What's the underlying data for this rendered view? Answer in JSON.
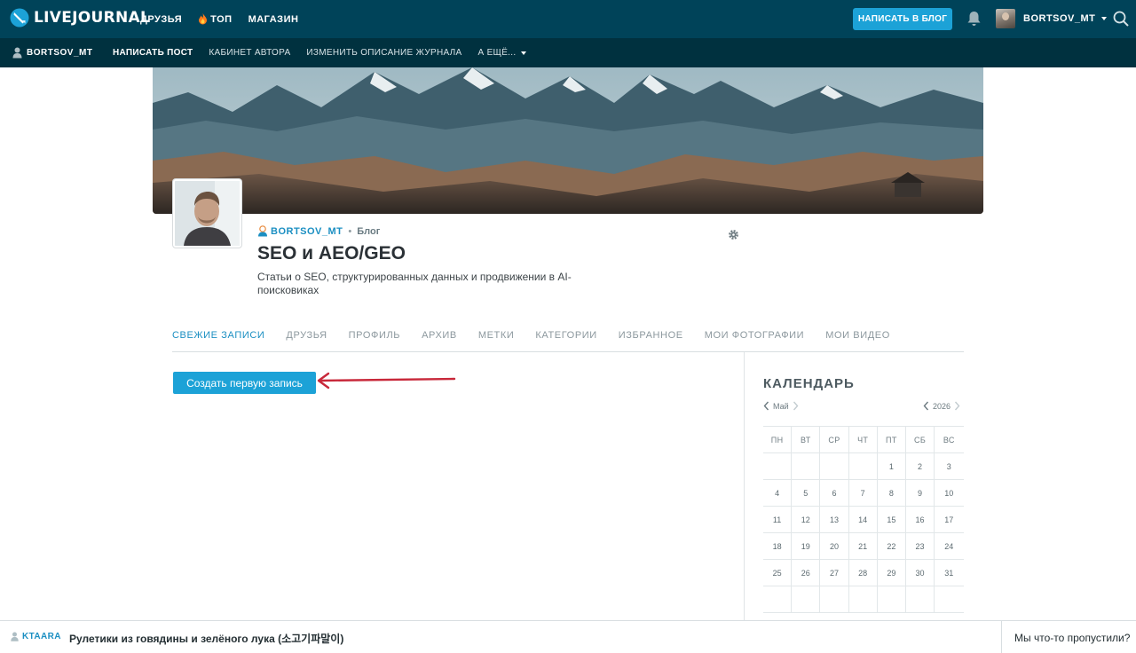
{
  "topbar": {
    "logo_text": "LIVEJOURNAL",
    "nav": [
      "ДРУЗЬЯ",
      "ТОП",
      "МАГАЗИН"
    ],
    "write_button": "НАПИСАТЬ В БЛОГ",
    "username": "BORTSOV_MT",
    "icons": [
      "livejournal-logo-icon",
      "fire-icon",
      "bell-icon",
      "caret-down-icon",
      "search-icon"
    ]
  },
  "subbar": {
    "username": "BORTSOV_MT",
    "items": [
      "НАПИСАТЬ ПОСТ",
      "КАБИНЕТ АВТОРА",
      "ИЗМЕНИТЬ ОПИСАНИЕ ЖУРНАЛА",
      "А ЕЩЁ..."
    ]
  },
  "journal": {
    "username": "BORTSOV_MT",
    "kind": "Блог",
    "separator": "•",
    "title": "SEO и AEO/GEO",
    "description": "Статьи о SEO, структурированных данных и продвижении в AI-поисковиках"
  },
  "tabs": [
    "СВЕЖИЕ ЗАПИСИ",
    "ДРУЗЬЯ",
    "ПРОФИЛЬ",
    "АРХИВ",
    "МЕТКИ",
    "КАТЕГОРИИ",
    "ИЗБРАННОЕ",
    "МОИ ФОТОГРАФИИ",
    "МОИ ВИДЕО"
  ],
  "active_tab": "СВЕЖИЕ ЗАПИСИ",
  "main": {
    "create_button": "Создать первую запись"
  },
  "calendar": {
    "title": "КАЛЕНДАРЬ",
    "month": "Май",
    "year": "2026",
    "weekdays": [
      "ПН",
      "ВТ",
      "СР",
      "ЧТ",
      "ПТ",
      "СБ",
      "ВС"
    ],
    "weeks": [
      [
        "",
        "",
        "",
        "",
        "1",
        "2",
        "3"
      ],
      [
        "4",
        "5",
        "6",
        "7",
        "8",
        "9",
        "10"
      ],
      [
        "11",
        "12",
        "13",
        "14",
        "15",
        "16",
        "17"
      ],
      [
        "18",
        "19",
        "20",
        "21",
        "22",
        "23",
        "24"
      ],
      [
        "25",
        "26",
        "27",
        "28",
        "29",
        "30",
        "31"
      ],
      [
        "",
        "",
        "",
        "",
        "",
        "",
        ""
      ]
    ]
  },
  "bottombar": {
    "username": "KTAARA",
    "title": "Рулетики из говядины и зелёного лука (소고기파말이)",
    "missed": "Мы что-то пропустили?"
  },
  "colors": {
    "topbar": "#004359",
    "subbar": "#00313f",
    "accent": "#1ca2d7",
    "link": "#1b8fc2",
    "arrow": "#c8283a"
  }
}
